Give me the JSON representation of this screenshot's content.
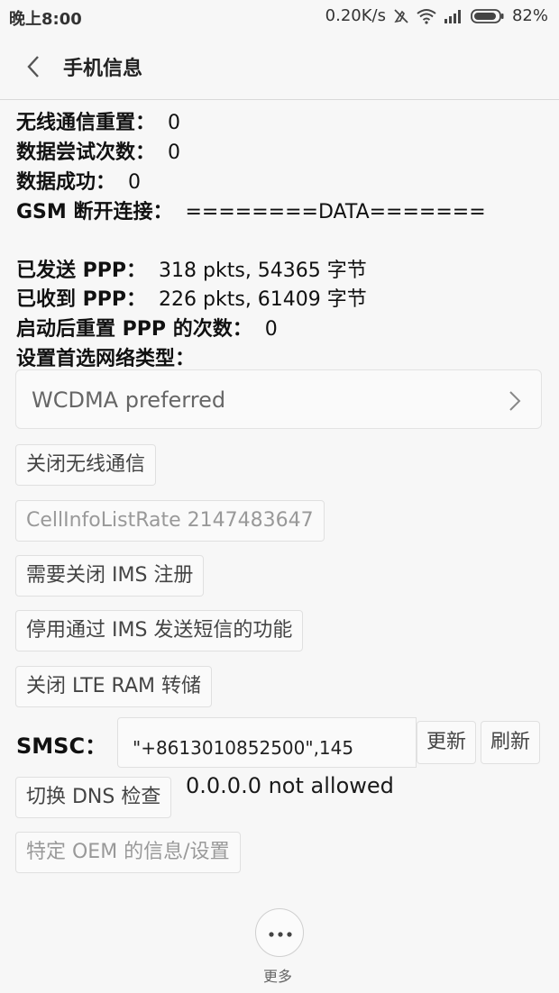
{
  "status_bar": {
    "time": "晚上8:00",
    "network_speed": "0.20K/s",
    "battery": "82%",
    "icons": [
      "no-sim-icon",
      "wifi-icon",
      "signal-icon",
      "battery-icon"
    ]
  },
  "header": {
    "title": "手机信息",
    "back_icon": "chevron-left-icon"
  },
  "info": {
    "radio_reset": {
      "label": "无线通信重置：",
      "value": "0"
    },
    "data_attempts": {
      "label": "数据尝试次数：",
      "value": "0"
    },
    "data_success": {
      "label": "数据成功：",
      "value": "0"
    },
    "gsm_disconnect": {
      "label": "GSM 断开连接：",
      "value": "========DATA======="
    },
    "ppp_sent": {
      "label": "已发送 PPP：",
      "value": "318 pkts, 54365 字节"
    },
    "ppp_received": {
      "label": "已收到 PPP：",
      "value": "226 pkts, 61409 字节"
    },
    "ppp_resets": {
      "label": "启动后重置 PPP 的次数：",
      "value": "0"
    },
    "preferred_network_label": "设置首选网络类型："
  },
  "network_select": {
    "value": "WCDMA preferred",
    "chevron_icon": "chevron-right-icon"
  },
  "buttons": {
    "radio_off": "关闭无线通信",
    "cell_info_rate": "CellInfoListRate 2147483647",
    "ims_off": "需要关闭 IMS 注册",
    "ims_sms_off": "停用通过 IMS 发送短信的功能",
    "lte_ram_dump": "关闭 LTE RAM 转储",
    "update": "更新",
    "refresh": "刷新",
    "dns_toggle": "切换 DNS 检查",
    "oem_info": "特定 OEM 的信息/设置"
  },
  "smsc": {
    "label": "SMSC：",
    "value": "\"+8613010852500\",145"
  },
  "dns_status": "0.0.0.0 not allowed",
  "more": {
    "label": "更多",
    "icon": "more-dots-icon"
  }
}
